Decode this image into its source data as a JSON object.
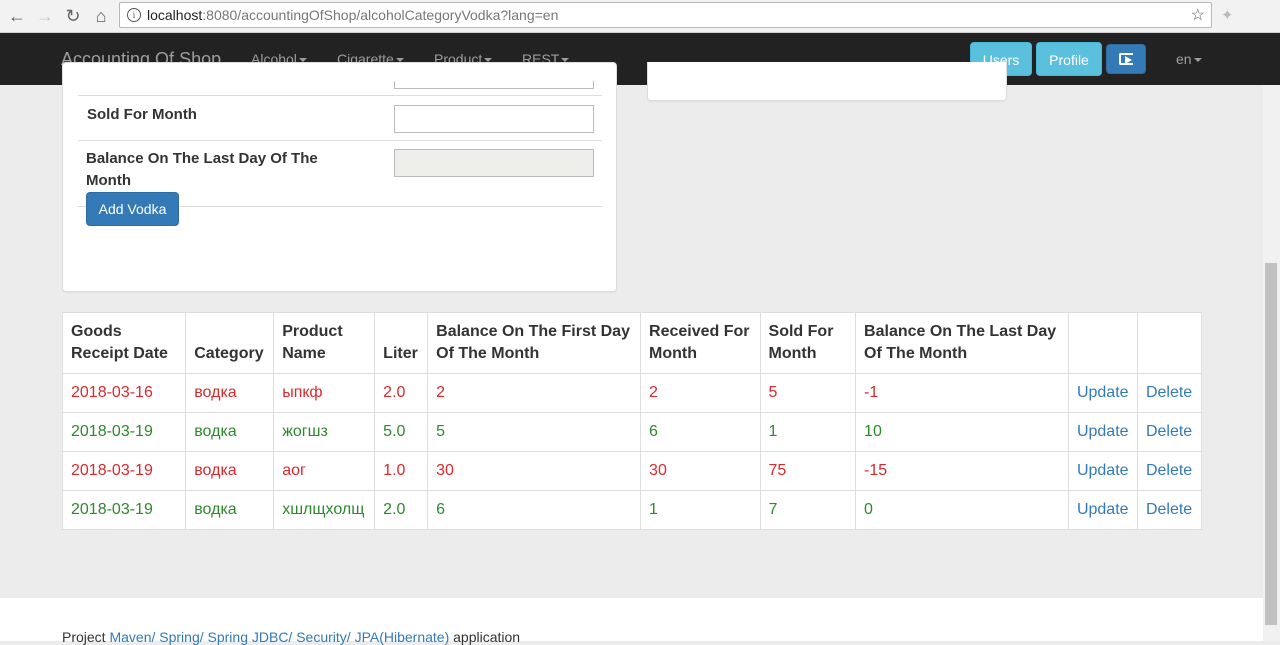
{
  "browser": {
    "url_host": "localhost",
    "url_path": ":8080/accountingOfShop/alcoholCategoryVodka?lang=en",
    "back_icon": "arrow-left-icon",
    "forward_icon": "arrow-right-icon",
    "reload_icon": "reload-icon",
    "home_icon": "home-icon",
    "bookmark_icon": "star-icon"
  },
  "navbar": {
    "brand": "Accounting Of Shop",
    "menus": [
      "Alcohol",
      "Cigarette",
      "Product",
      "REST"
    ],
    "users_label": "Users",
    "profile_label": "Profile",
    "lang": "en"
  },
  "form": {
    "sold_label": "Sold For Month",
    "balance_last_label": "Balance On The Last Day Of The Month",
    "add_button": "Add Vodka"
  },
  "table": {
    "headers": [
      "Goods Receipt Date",
      "Category",
      "Product Name",
      "Liter",
      "Balance On The First Day Of The Month",
      "Received For Month",
      "Sold For Month",
      "Balance On The Last Day Of The Month",
      "",
      ""
    ],
    "rows": [
      {
        "status": "red",
        "cells": [
          "2018-03-16",
          "водка",
          "ыпкф",
          "2.0",
          "2",
          "2",
          "5",
          "-1"
        ],
        "update": "Update",
        "delete": "Delete"
      },
      {
        "status": "green",
        "cells": [
          "2018-03-19",
          "водка",
          "жогшз",
          "5.0",
          "5",
          "6",
          "1",
          "10"
        ],
        "update": "Update",
        "delete": "Delete"
      },
      {
        "status": "red",
        "cells": [
          "2018-03-19",
          "водка",
          "аог",
          "1.0",
          "30",
          "30",
          "75",
          "-15"
        ],
        "update": "Update",
        "delete": "Delete"
      },
      {
        "status": "green",
        "cells": [
          "2018-03-19",
          "водка",
          "хшлщхолщ",
          "2.0",
          "6",
          "1",
          "7",
          "0"
        ],
        "update": "Update",
        "delete": "Delete"
      }
    ]
  },
  "colors": {
    "negative_row": "#d9292c",
    "positive_row": "#2c8a2c",
    "navbar": "#222222",
    "info": "#5bc0de",
    "primary": "#337ab7"
  },
  "footer": {
    "prefix": "Project ",
    "link": "Maven/ Spring/ Spring JDBC/ Security/ JPA(Hibernate)",
    "suffix": " application"
  }
}
